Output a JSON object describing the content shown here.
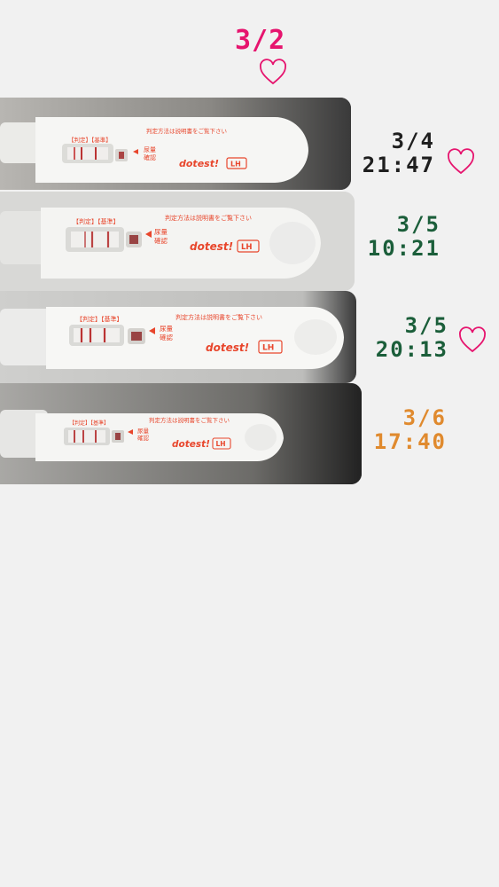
{
  "header": {
    "date": "3/2",
    "color": "#e6146e"
  },
  "strip_text": {
    "window_labels": "【判定】【基準】",
    "side_label_1": "尿量",
    "side_label_2": "確認",
    "instruction": "判定方法は説明書をご覧下さい",
    "brand": "dotest!",
    "badge": "LH"
  },
  "entries": [
    {
      "date": "3/4",
      "time": "21:47",
      "color": "#1f1f1f",
      "heart": true
    },
    {
      "date": "3/5",
      "time": "10:21",
      "color": "#1b5e3a",
      "heart": false
    },
    {
      "date": "3/5",
      "time": "20:13",
      "color": "#1b5e3a",
      "heart": true
    },
    {
      "date": "3/6",
      "time": "17:40",
      "color": "#e08a2e",
      "heart": false
    }
  ],
  "heart_color": "#e6146e"
}
